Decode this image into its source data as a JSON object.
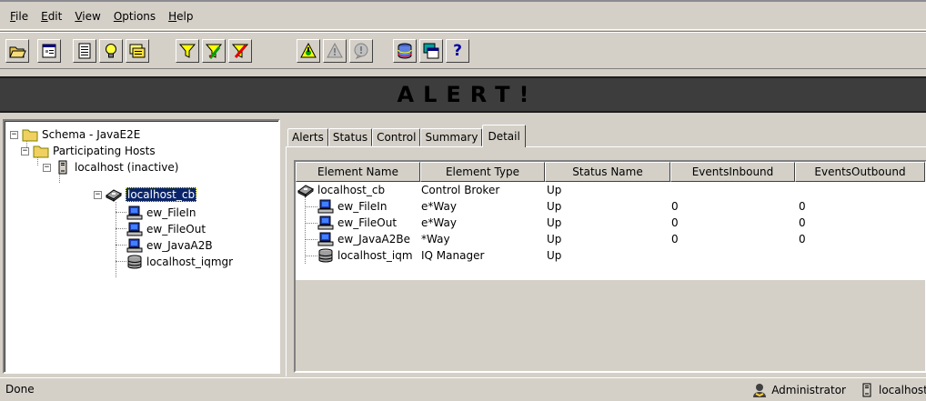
{
  "menu": {
    "items": [
      {
        "mnemonic": "F",
        "rest": "ile"
      },
      {
        "mnemonic": "E",
        "rest": "dit"
      },
      {
        "mnemonic": "V",
        "rest": "iew"
      },
      {
        "mnemonic": "O",
        "rest": "ptions"
      },
      {
        "mnemonic": "H",
        "rest": "elp"
      }
    ]
  },
  "toolbar": {
    "help_label": "?",
    "icons": [
      "open-folder-icon",
      "properties-icon",
      "notepad-icon",
      "lightbulb-icon",
      "notes-icon",
      "filter-icon",
      "filter-edit-icon",
      "filter-remove-icon",
      "alert-warning-icon",
      "alert-gray-icon",
      "alert-bubble-icon",
      "database-icon",
      "window-icon",
      "help-icon"
    ]
  },
  "banner": {
    "text": "ALERT!"
  },
  "tree": {
    "root": "Schema - JavaE2E",
    "participating": "Participating Hosts",
    "host": "localhost (inactive)",
    "broker": "localhost_cb",
    "children": [
      "ew_FileIn",
      "ew_FileOut",
      "ew_JavaA2B",
      "localhost_iqmgr"
    ]
  },
  "tabs": [
    "Alerts",
    "Status",
    "Control",
    "Summary",
    "Detail"
  ],
  "active_tab": "Detail",
  "table": {
    "columns": [
      "Element Name",
      "Element Type",
      "Status Name",
      "EventsInbound",
      "EventsOutbound"
    ],
    "rows": [
      {
        "name": "localhost_cb",
        "type": "Control Broker",
        "status": "Up",
        "inbound": "",
        "outbound": ""
      },
      {
        "name": "ew_FileIn",
        "type": "e*Way",
        "status": "Up",
        "inbound": "0",
        "outbound": "0"
      },
      {
        "name": "ew_FileOut",
        "type": "e*Way",
        "status": "Up",
        "inbound": "0",
        "outbound": "0"
      },
      {
        "name": "ew_JavaA2Be",
        "type": "*Way",
        "status": "Up",
        "inbound": "0",
        "outbound": "0"
      },
      {
        "name": "localhost_iqm",
        "type": "IQ Manager",
        "status": "Up",
        "inbound": "",
        "outbound": ""
      }
    ]
  },
  "status": {
    "text": "Done",
    "user": "Administrator",
    "host": "localhost"
  },
  "colors": {
    "selection": "#0a246a",
    "banner_bg": "#3d3d3d",
    "chrome": "#d4d0c8"
  }
}
